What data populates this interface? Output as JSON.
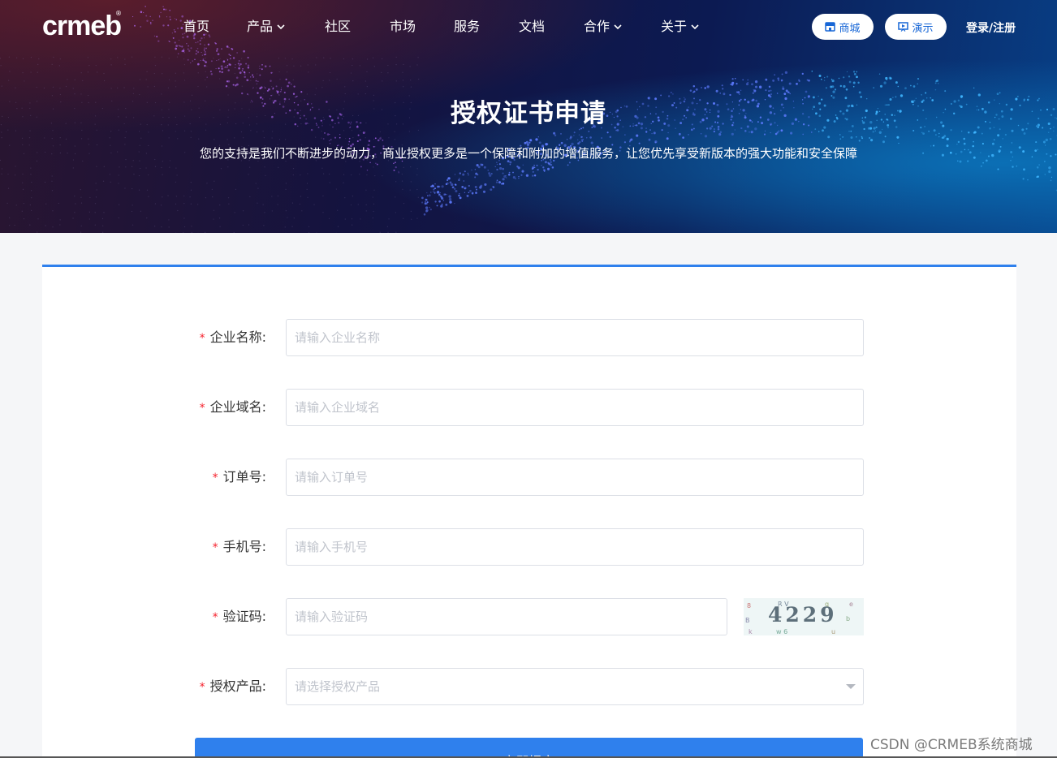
{
  "brand": {
    "logo_text": "crmeb",
    "registered_mark": "®"
  },
  "nav": {
    "items": [
      {
        "label": "首页",
        "has_dropdown": false
      },
      {
        "label": "产品",
        "has_dropdown": true
      },
      {
        "label": "社区",
        "has_dropdown": false
      },
      {
        "label": "市场",
        "has_dropdown": false
      },
      {
        "label": "服务",
        "has_dropdown": false
      },
      {
        "label": "文档",
        "has_dropdown": false
      },
      {
        "label": "合作",
        "has_dropdown": true
      },
      {
        "label": "关于",
        "has_dropdown": true
      }
    ],
    "mall_button": "商城",
    "demo_button": "演示",
    "login_link": "登录/注册"
  },
  "hero": {
    "title": "授权证书申请",
    "subtitle": "您的支持是我们不断进步的动力，商业授权更多是一个保障和附加的增值服务，让您优先享受新版本的强大功能和安全保障"
  },
  "form": {
    "fields": [
      {
        "label": "企业名称:",
        "placeholder": "请输入企业名称",
        "required": true
      },
      {
        "label": "企业域名:",
        "placeholder": "请输入企业域名",
        "required": true
      },
      {
        "label": "订单号:",
        "placeholder": "请输入订单号",
        "required": true
      },
      {
        "label": "手机号:",
        "placeholder": "请输入手机号",
        "required": true
      },
      {
        "label": "验证码:",
        "placeholder": "请输入验证码",
        "required": true
      },
      {
        "label": "授权产品:",
        "placeholder": "请选择授权产品",
        "required": true
      }
    ],
    "required_mark": "*",
    "captcha_text": "4229",
    "submit_label": "立即提交"
  },
  "watermark": "CSDN @CRMEB系统商城",
  "colors": {
    "accent": "#2f80ed",
    "required": "#f5222d",
    "pill_text": "#1766d6"
  }
}
